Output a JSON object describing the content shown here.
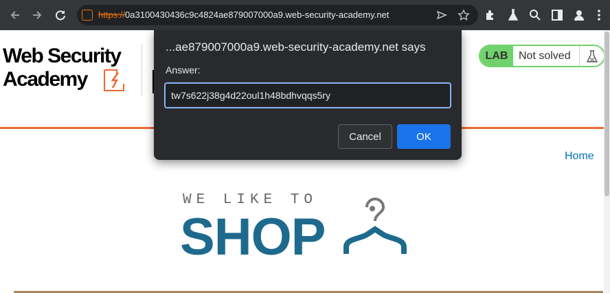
{
  "browser": {
    "url_scheme": "https://",
    "url_rest": "0a3100430436c9c4824ae879007000a9.web-security-academy.net"
  },
  "page": {
    "logo": {
      "line1": "Web Security",
      "line2": "Academy"
    },
    "lab_badge": {
      "label": "LAB",
      "status": "Not solved"
    },
    "nav": {
      "home": "Home"
    },
    "shop_banner": {
      "tagline": "WE LIKE TO",
      "title": "SHOP"
    }
  },
  "dialog": {
    "title": "...ae879007000a9.web-security-academy.net says",
    "prompt": "Answer:",
    "input_value": "tw7s622j38g4d22oul1h48bdhvqqs5ry",
    "cancel_label": "Cancel",
    "ok_label": "OK"
  },
  "colors": {
    "accent_orange": "#ec6933",
    "lab_green": "#70d16d",
    "shop_blue": "#1e6a8d",
    "dialog_ok": "#1a73e8"
  }
}
